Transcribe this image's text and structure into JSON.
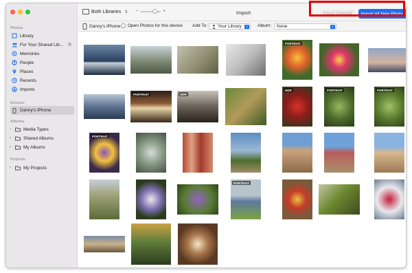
{
  "sidebar": {
    "sections": {
      "photos": "Photos",
      "devices": "Devices",
      "albums": "Albums",
      "projects": "Projects"
    },
    "items": [
      {
        "label": "Library",
        "icon": "library-icon"
      },
      {
        "label": "For Your Shared Lib...",
        "icon": "shared-library-icon",
        "badge": "8"
      },
      {
        "label": "Memories",
        "icon": "memories-icon"
      },
      {
        "label": "People",
        "icon": "people-icon"
      },
      {
        "label": "Places",
        "icon": "places-icon"
      },
      {
        "label": "Recents",
        "icon": "recents-icon"
      },
      {
        "label": "Imports",
        "icon": "imports-icon"
      }
    ],
    "device": "Danny's iPhone",
    "albums": [
      "Media Types",
      "Shared Albums",
      "My Albums"
    ],
    "projects": [
      "My Projects"
    ]
  },
  "toolbar": {
    "library_select": "Both Libraries",
    "title": "Import",
    "import_selected": "Import Selected",
    "import_all": "Import All New Photos",
    "zoom_minus": "−",
    "zoom_plus": "+",
    "zoom_level": 0.7
  },
  "subbar": {
    "device_label": "Danny's iPhone",
    "open_photos_label": "Open Photos for this device",
    "add_to_label": "Add To:",
    "add_to_value": "Your Library",
    "album_label": "Album:",
    "album_value": "None"
  },
  "photos": [
    {
      "tag": ""
    },
    {
      "tag": ""
    },
    {
      "tag": ""
    },
    {
      "tag": ""
    },
    {
      "tag": "PORTRAIT"
    },
    {
      "tag": ""
    },
    {
      "tag": ""
    },
    {
      "tag": ""
    },
    {
      "tag": "PORTRAIT"
    },
    {
      "tag": "HDR"
    },
    {
      "tag": ""
    },
    {
      "tag": "HDR"
    },
    {
      "tag": "PORTRAIT"
    },
    {
      "tag": "PORTRAIT"
    },
    {
      "tag": "PORTRAIT"
    },
    {
      "tag": ""
    },
    {
      "tag": ""
    },
    {
      "tag": ""
    },
    {
      "tag": ""
    },
    {
      "tag": ""
    },
    {
      "tag": ""
    },
    {
      "tag": ""
    },
    {
      "tag": ""
    },
    {
      "tag": ""
    },
    {
      "tag": "PORTRAIT"
    },
    {
      "tag": ""
    },
    {
      "tag": ""
    },
    {
      "tag": ""
    },
    {
      "tag": ""
    },
    {
      "tag": ""
    },
    {
      "tag": ""
    }
  ],
  "colors": {
    "accent": "#1c6ef2",
    "highlight": "#e00000"
  }
}
